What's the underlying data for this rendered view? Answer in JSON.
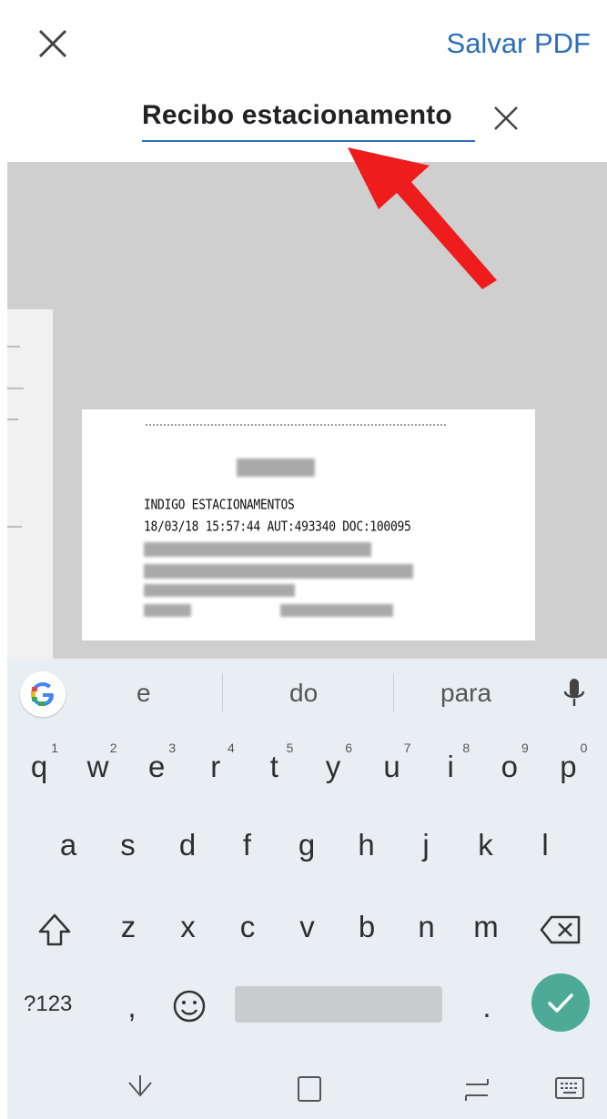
{
  "header": {
    "save_label": "Salvar PDF",
    "title_value": "Recibo estacionamento"
  },
  "colors": {
    "accent": "#2c6fb8",
    "enter_key": "#4caa96",
    "arrow": "#ee1c1c"
  },
  "receipt": {
    "line1": "INDIGO ESTACIONAMENTOS",
    "line2": "18/03/18 15:57:44 AUT:493340 DOC:100095"
  },
  "keyboard": {
    "suggestions": [
      "e",
      "do",
      "para"
    ],
    "row1": [
      {
        "k": "q",
        "n": "1"
      },
      {
        "k": "w",
        "n": "2"
      },
      {
        "k": "e",
        "n": "3"
      },
      {
        "k": "r",
        "n": "4"
      },
      {
        "k": "t",
        "n": "5"
      },
      {
        "k": "y",
        "n": "6"
      },
      {
        "k": "u",
        "n": "7"
      },
      {
        "k": "i",
        "n": "8"
      },
      {
        "k": "o",
        "n": "9"
      },
      {
        "k": "p",
        "n": "0"
      }
    ],
    "row2": [
      "a",
      "s",
      "d",
      "f",
      "g",
      "h",
      "j",
      "k",
      "l"
    ],
    "row3": [
      "z",
      "x",
      "c",
      "v",
      "b",
      "n",
      "m"
    ],
    "symbols_label": "?123",
    "comma": ",",
    "period": "."
  },
  "icons": {
    "close": "close-icon",
    "clear": "clear-text-icon",
    "google": "google-icon",
    "mic": "mic-icon",
    "shift": "shift-icon",
    "backspace": "backspace-icon",
    "emoji": "emoji-icon",
    "enter": "check-icon",
    "nav_hide": "chevron-down-icon",
    "nav_recents": "recents-icon",
    "nav_switch": "switch-icon",
    "nav_keyboard": "keyboard-icon"
  }
}
